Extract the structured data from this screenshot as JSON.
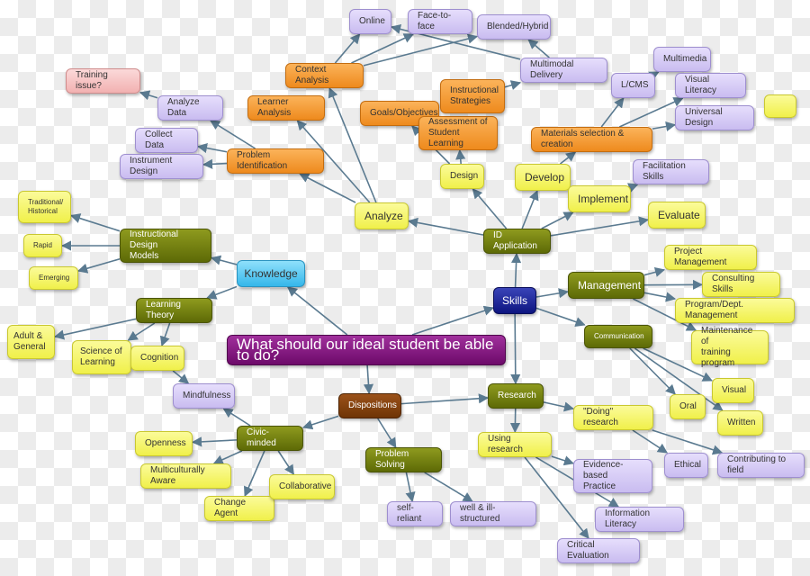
{
  "title": "What should our ideal student be able to do?",
  "colors": {
    "edge": "#5a7a90",
    "yellow": "#f0f04a",
    "purple": "#c9bcf0",
    "orange": "#ee8a1d",
    "pink": "#f2b1b1",
    "olive": "#5d6a06",
    "blue": "#35b7ea",
    "navy": "#0d1580",
    "brown": "#6e3405",
    "violet": "#6d0a6a"
  },
  "nodes": [
    {
      "id": "root",
      "label": "What should our ideal student be able to do?",
      "color": "violet"
    },
    {
      "id": "knowledge",
      "label": "Knowledge",
      "color": "blue"
    },
    {
      "id": "skills",
      "label": "Skills",
      "color": "navy"
    },
    {
      "id": "dispositions",
      "label": "Dispositions",
      "color": "brown"
    },
    {
      "id": "id-models",
      "label": "Instructional Design\nModels",
      "color": "olive"
    },
    {
      "id": "traditional",
      "label": "Traditional/\nHistorical",
      "color": "yellow"
    },
    {
      "id": "rapid",
      "label": "Rapid",
      "color": "yellow"
    },
    {
      "id": "emerging",
      "label": "Emerging",
      "color": "yellow"
    },
    {
      "id": "learning-theory",
      "label": "Learning Theory",
      "color": "olive"
    },
    {
      "id": "adult",
      "label": "Adult &\nGeneral",
      "color": "yellow"
    },
    {
      "id": "science",
      "label": "Science of\nLearning",
      "color": "yellow"
    },
    {
      "id": "cognition",
      "label": "Cognition",
      "color": "yellow"
    },
    {
      "id": "mindfulness",
      "label": "Mindfulness",
      "color": "purple"
    },
    {
      "id": "civic",
      "label": "Civic-minded",
      "color": "olive"
    },
    {
      "id": "openness",
      "label": "Openness",
      "color": "yellow"
    },
    {
      "id": "multicultural",
      "label": "Multiculturally Aware",
      "color": "yellow"
    },
    {
      "id": "change-agent",
      "label": "Change Agent",
      "color": "yellow"
    },
    {
      "id": "collaborative",
      "label": "Collaborative",
      "color": "yellow"
    },
    {
      "id": "problem-solving",
      "label": "Problem Solving",
      "color": "olive"
    },
    {
      "id": "self-reliant",
      "label": "self-reliant",
      "color": "purple"
    },
    {
      "id": "well-ill",
      "label": "well & ill-structured",
      "color": "purple"
    },
    {
      "id": "research",
      "label": "Research",
      "color": "olive"
    },
    {
      "id": "using-research",
      "label": "Using research",
      "color": "yellow"
    },
    {
      "id": "doing-research",
      "label": "\"Doing\" research",
      "color": "yellow"
    },
    {
      "id": "evidence",
      "label": "Evidence-based\nPractice",
      "color": "purple"
    },
    {
      "id": "info-literacy",
      "label": "Information Literacy",
      "color": "purple"
    },
    {
      "id": "critical",
      "label": "Critical Evaluation",
      "color": "purple"
    },
    {
      "id": "ethical",
      "label": "Ethical",
      "color": "purple"
    },
    {
      "id": "contributing",
      "label": "Contributing to field",
      "color": "purple"
    },
    {
      "id": "management",
      "label": "Management",
      "color": "olive"
    },
    {
      "id": "project-mgmt",
      "label": "Project Management",
      "color": "yellow"
    },
    {
      "id": "consulting",
      "label": "Consulting Skills",
      "color": "yellow"
    },
    {
      "id": "program-mgmt",
      "label": "Program/Dept. Management",
      "color": "yellow"
    },
    {
      "id": "maintenance",
      "label": "Maintenance of\ntraining program",
      "color": "yellow"
    },
    {
      "id": "communication",
      "label": "Communication",
      "color": "olive"
    },
    {
      "id": "visual",
      "label": "Visual",
      "color": "yellow"
    },
    {
      "id": "oral",
      "label": "Oral",
      "color": "yellow"
    },
    {
      "id": "written",
      "label": "Written",
      "color": "yellow"
    },
    {
      "id": "id-application",
      "label": "ID Application",
      "color": "olive"
    },
    {
      "id": "analyze",
      "label": "Analyze",
      "color": "yellow"
    },
    {
      "id": "design",
      "label": "Design",
      "color": "yellow"
    },
    {
      "id": "develop",
      "label": "Develop",
      "color": "yellow"
    },
    {
      "id": "implement",
      "label": "Implement",
      "color": "yellow"
    },
    {
      "id": "evaluate",
      "label": "Evaluate",
      "color": "yellow"
    },
    {
      "id": "facilitation",
      "label": "Facilitation Skills",
      "color": "purple"
    },
    {
      "id": "materials",
      "label": "Materials selection & creation",
      "color": "orange"
    },
    {
      "id": "lcms",
      "label": "L/CMS",
      "color": "purple"
    },
    {
      "id": "multimedia",
      "label": "Multimedia",
      "color": "purple"
    },
    {
      "id": "visual-literacy",
      "label": "Visual Literacy",
      "color": "purple"
    },
    {
      "id": "universal-design",
      "label": "Universal Design",
      "color": "purple"
    },
    {
      "id": "blank",
      "label": "",
      "color": "yellow"
    },
    {
      "id": "goals",
      "label": "Goals/Objectives",
      "color": "orange"
    },
    {
      "id": "assessment",
      "label": "Assessment of\nStudent Learning",
      "color": "orange"
    },
    {
      "id": "strategies",
      "label": "Instructional\nStrategies",
      "color": "orange"
    },
    {
      "id": "multimodal",
      "label": "Multimodal Delivery",
      "color": "purple"
    },
    {
      "id": "online",
      "label": "Online",
      "color": "purple"
    },
    {
      "id": "face",
      "label": "Face-to-face",
      "color": "purple"
    },
    {
      "id": "blended",
      "label": "Blended/Hybrid",
      "color": "purple"
    },
    {
      "id": "context",
      "label": "Context Analysis",
      "color": "orange"
    },
    {
      "id": "learner",
      "label": "Learner Analysis",
      "color": "orange"
    },
    {
      "id": "problem-id",
      "label": "Problem Identification",
      "color": "orange"
    },
    {
      "id": "analyze-data",
      "label": "Analyze Data",
      "color": "purple"
    },
    {
      "id": "collect-data",
      "label": "Collect Data",
      "color": "purple"
    },
    {
      "id": "instrument",
      "label": "Instrument Design",
      "color": "purple"
    },
    {
      "id": "training-issue",
      "label": "Training issue?",
      "color": "pink"
    }
  ],
  "edges": [
    [
      "root",
      "knowledge"
    ],
    [
      "root",
      "skills"
    ],
    [
      "root",
      "dispositions"
    ],
    [
      "knowledge",
      "id-models"
    ],
    [
      "knowledge",
      "learning-theory"
    ],
    [
      "id-models",
      "traditional"
    ],
    [
      "id-models",
      "rapid"
    ],
    [
      "id-models",
      "emerging"
    ],
    [
      "learning-theory",
      "adult"
    ],
    [
      "learning-theory",
      "science"
    ],
    [
      "learning-theory",
      "cognition"
    ],
    [
      "cognition",
      "mindfulness"
    ],
    [
      "dispositions",
      "civic"
    ],
    [
      "dispositions",
      "problem-solving"
    ],
    [
      "dispositions",
      "research"
    ],
    [
      "civic",
      "mindfulness"
    ],
    [
      "civic",
      "openness"
    ],
    [
      "civic",
      "multicultural"
    ],
    [
      "civic",
      "change-agent"
    ],
    [
      "civic",
      "collaborative"
    ],
    [
      "problem-solving",
      "self-reliant"
    ],
    [
      "problem-solving",
      "well-ill"
    ],
    [
      "skills",
      "research"
    ],
    [
      "skills",
      "id-application"
    ],
    [
      "skills",
      "management"
    ],
    [
      "skills",
      "communication"
    ],
    [
      "research",
      "using-research"
    ],
    [
      "research",
      "doing-research"
    ],
    [
      "using-research",
      "evidence"
    ],
    [
      "using-research",
      "info-literacy"
    ],
    [
      "using-research",
      "critical"
    ],
    [
      "doing-research",
      "ethical"
    ],
    [
      "doing-research",
      "contributing"
    ],
    [
      "management",
      "project-mgmt"
    ],
    [
      "management",
      "consulting"
    ],
    [
      "management",
      "program-mgmt"
    ],
    [
      "management",
      "maintenance"
    ],
    [
      "communication",
      "oral"
    ],
    [
      "communication",
      "visual"
    ],
    [
      "communication",
      "written"
    ],
    [
      "id-application",
      "analyze"
    ],
    [
      "id-application",
      "design"
    ],
    [
      "id-application",
      "develop"
    ],
    [
      "id-application",
      "implement"
    ],
    [
      "id-application",
      "evaluate"
    ],
    [
      "implement",
      "facilitation"
    ],
    [
      "develop",
      "materials"
    ],
    [
      "materials",
      "lcms"
    ],
    [
      "materials",
      "visual-literacy"
    ],
    [
      "materials",
      "universal-design"
    ],
    [
      "lcms",
      "multimedia"
    ],
    [
      "design",
      "goals"
    ],
    [
      "design",
      "assessment"
    ],
    [
      "strategies",
      "multimodal"
    ],
    [
      "multimodal",
      "online"
    ],
    [
      "multimodal",
      "blended"
    ],
    [
      "context",
      "online"
    ],
    [
      "context",
      "face"
    ],
    [
      "context",
      "blended"
    ],
    [
      "analyze",
      "context"
    ],
    [
      "analyze",
      "learner"
    ],
    [
      "analyze",
      "problem-id"
    ],
    [
      "problem-id",
      "analyze-data"
    ],
    [
      "problem-id",
      "collect-data"
    ],
    [
      "problem-id",
      "instrument"
    ],
    [
      "analyze-data",
      "training-issue"
    ]
  ]
}
